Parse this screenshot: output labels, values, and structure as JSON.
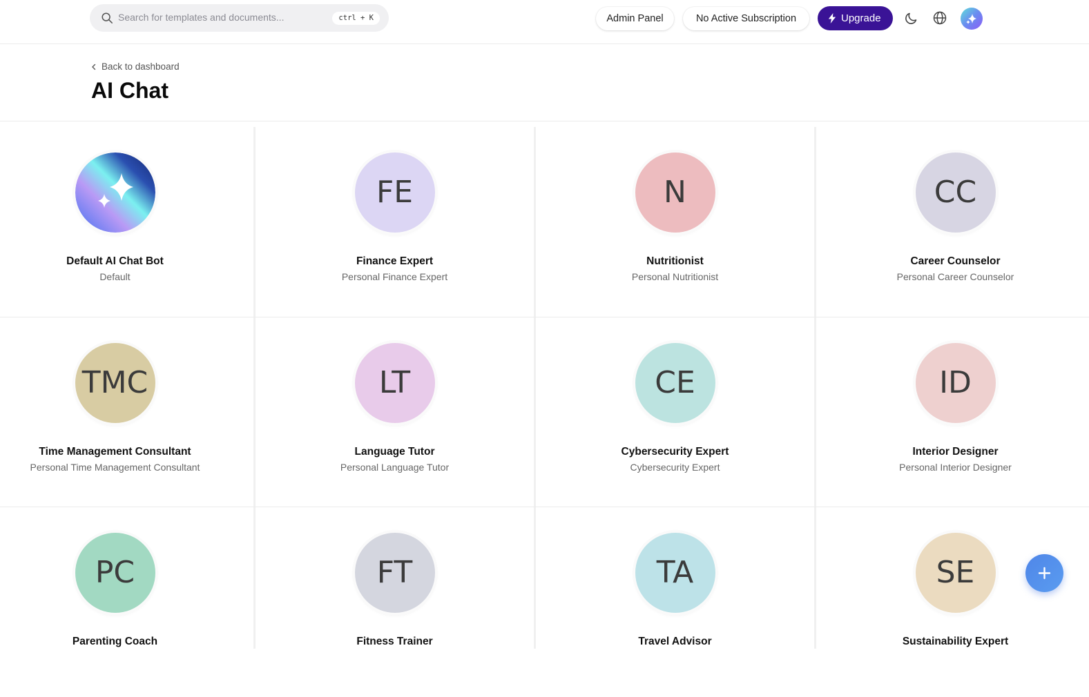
{
  "header": {
    "search_placeholder": "Search for templates and documents...",
    "search_shortcut": "ctrl + K",
    "admin_label": "Admin Panel",
    "subscription_label": "No Active Subscription",
    "upgrade_label": "Upgrade",
    "upgrade_color": "#3a1396"
  },
  "page": {
    "back_label": "Back to dashboard",
    "title": "AI Chat"
  },
  "bots": [
    {
      "initials": "",
      "name": "Default AI Chat Bot",
      "role": "Default",
      "color": "gradient",
      "icon": "sparkle-icon"
    },
    {
      "initials": "FE",
      "name": "Finance Expert",
      "role": "Personal Finance Expert",
      "color": "#dcd6f4"
    },
    {
      "initials": "N",
      "name": "Nutritionist",
      "role": "Personal Nutritionist",
      "color": "#edbcbf"
    },
    {
      "initials": "CC",
      "name": "Career Counselor",
      "role": "Personal Career Counselor",
      "color": "#d7d5e3"
    },
    {
      "initials": "TMC",
      "name": "Time Management Consultant",
      "role": "Personal Time Management Consultant",
      "color": "#d8cca3"
    },
    {
      "initials": "LT",
      "name": "Language Tutor",
      "role": "Personal Language Tutor",
      "color": "#e8cbea"
    },
    {
      "initials": "CE",
      "name": "Cybersecurity Expert",
      "role": "Cybersecurity Expert",
      "color": "#bce3e0"
    },
    {
      "initials": "ID",
      "name": "Interior Designer",
      "role": "Personal Interior Designer",
      "color": "#eed0cf"
    },
    {
      "initials": "PC",
      "name": "Parenting Coach",
      "role": "",
      "color": "#a2d9c2"
    },
    {
      "initials": "FT",
      "name": "Fitness Trainer",
      "role": "",
      "color": "#d4d6df"
    },
    {
      "initials": "TA",
      "name": "Travel Advisor",
      "role": "",
      "color": "#bde2e8"
    },
    {
      "initials": "SE",
      "name": "Sustainability Expert",
      "role": "",
      "color": "#ebdbc0"
    }
  ]
}
